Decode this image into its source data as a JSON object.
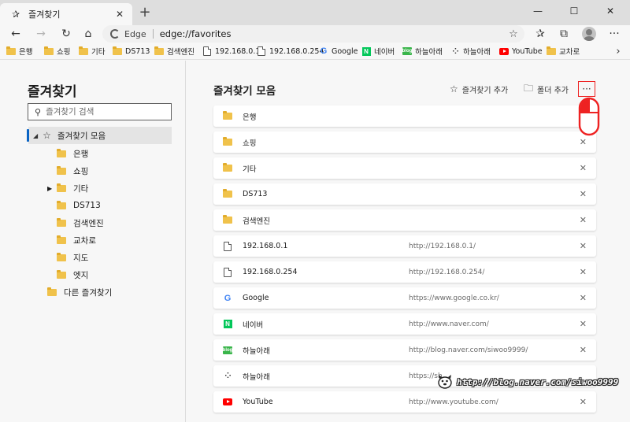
{
  "tab": {
    "title": "즐겨찾기",
    "close": "✕"
  },
  "newtab": "+",
  "window": {
    "minimize": "—",
    "maximize": "☐",
    "close": "✕"
  },
  "nav": {
    "back": "←",
    "forward": "→",
    "refresh": "↻",
    "home": "⌂",
    "site_label": "Edge",
    "url": "edge://favorites",
    "favorite": "☆",
    "collections": "✰",
    "extensions": "⧉",
    "menu": "···"
  },
  "bookmarks": [
    {
      "label": "은행",
      "icon": "folder-icon"
    },
    {
      "label": "쇼핑",
      "icon": "folder-icon"
    },
    {
      "label": "기타",
      "icon": "folder-icon"
    },
    {
      "label": "DS713",
      "icon": "folder-icon"
    },
    {
      "label": "검색엔진",
      "icon": "folder-icon"
    },
    {
      "label": "192.168.0.1",
      "icon": "page-icon"
    },
    {
      "label": "192.168.0.254",
      "icon": "page-icon"
    },
    {
      "label": "Google",
      "icon": "google-icon"
    },
    {
      "label": "네이버",
      "icon": "naver-icon"
    },
    {
      "label": "하늘아래",
      "icon": "blog-icon"
    },
    {
      "label": "하늘아래",
      "icon": "dots-icon"
    },
    {
      "label": "YouTube",
      "icon": "youtube-icon"
    },
    {
      "label": "교차로",
      "icon": "folder-icon"
    }
  ],
  "bookmarks_more": "›",
  "sidebar": {
    "title": "즐겨찾기",
    "search_placeholder": "즐겨찾기 검색",
    "root": "즐겨찾기 모음",
    "items": [
      "은행",
      "쇼핑",
      "기타",
      "DS713",
      "검색엔진",
      "교차로",
      "지도",
      "엣지"
    ],
    "other": "다른 즐겨찾기"
  },
  "main": {
    "title": "즐겨찾기 모음",
    "add_favorite": "즐겨찾기 추가",
    "add_folder": "폴더 추가",
    "more": "···",
    "rows": [
      {
        "name": "은행",
        "url": "",
        "icon": "folder-icon",
        "close": ""
      },
      {
        "name": "쇼핑",
        "url": "",
        "icon": "folder-icon",
        "close": "✕"
      },
      {
        "name": "기타",
        "url": "",
        "icon": "folder-icon",
        "close": "✕"
      },
      {
        "name": "DS713",
        "url": "",
        "icon": "folder-icon",
        "close": "✕"
      },
      {
        "name": "검색엔진",
        "url": "",
        "icon": "folder-icon",
        "close": "✕"
      },
      {
        "name": "192.168.0.1",
        "url": "http://192.168.0.1/",
        "icon": "page-icon",
        "close": "✕"
      },
      {
        "name": "192.168.0.254",
        "url": "http://192.168.0.254/",
        "icon": "page-icon",
        "close": "✕"
      },
      {
        "name": "Google",
        "url": "https://www.google.co.kr/",
        "icon": "google-icon",
        "close": "✕"
      },
      {
        "name": "네이버",
        "url": "http://www.naver.com/",
        "icon": "naver-icon",
        "close": "✕"
      },
      {
        "name": "하늘아래",
        "url": "http://blog.naver.com/siwoo9999/",
        "icon": "blog-icon",
        "close": "✕"
      },
      {
        "name": "하늘아래",
        "url": "https://sh",
        "icon": "dots-icon",
        "close": ""
      },
      {
        "name": "YouTube",
        "url": "http://www.youtube.com/",
        "icon": "youtube-icon",
        "close": "✕"
      }
    ]
  },
  "watermark": "http://blog.naver.com/siwoo9999",
  "colors": {
    "folder": "#f0c24b",
    "accent": "#0a64c4",
    "highlight": "#e22222",
    "naver": "#03c75a",
    "youtube": "#ff0000"
  }
}
